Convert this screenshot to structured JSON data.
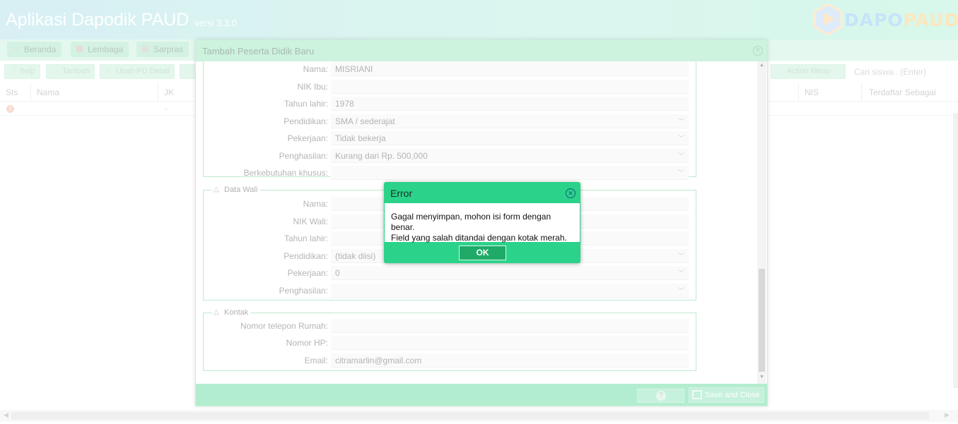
{
  "app": {
    "title": "Aplikasi Dapodik PAUD",
    "version": "versi 3.3.0",
    "logo_a": "DAPO",
    "logo_b": "PAUD"
  },
  "nav": {
    "beranda": "Beranda",
    "lembaga": "Lembaga",
    "sarpras": "Sarpras"
  },
  "toolbar": {
    "help": "help",
    "tambah": "Tambah",
    "ubah": "Ubah PD Detail",
    "action": "Action Menu",
    "search_placeholder": "Cari siswa.. (Enter)"
  },
  "grid": {
    "columns": {
      "sts": "Sts",
      "nama": "Nama",
      "jk": "JK",
      "nis": "NIS",
      "terdaftar": "Terdaftar Sebagai"
    },
    "row": {
      "jk": "-"
    }
  },
  "modal": {
    "title": "Tambah Peserta Didik Baru",
    "ibu": [
      {
        "label": "Nama:",
        "value": "MISRIANI"
      },
      {
        "label": "NIK Ibu:",
        "value": ""
      },
      {
        "label": "Tahun lahir:",
        "value": "1978"
      },
      {
        "label": "Pendidikan:",
        "value": "SMA / sederajat"
      },
      {
        "label": "Pekerjaan:",
        "value": "Tidak bekerja"
      },
      {
        "label": "Penghasilan:",
        "value": "Kurang dari Rp. 500,000"
      },
      {
        "label": "Berkebutuhan khusus:",
        "value": ""
      }
    ],
    "wali_legend": "Data Wali",
    "wali": [
      {
        "label": "Nama:",
        "value": ""
      },
      {
        "label": "NIK Wali:",
        "value": ""
      },
      {
        "label": "Tahun lahir:",
        "value": ""
      },
      {
        "label": "Pendidikan:",
        "value": "(tidak diisi)"
      },
      {
        "label": "Pekerjaan:",
        "value": "0"
      },
      {
        "label": "Penghasilan:",
        "value": ""
      }
    ],
    "kontak_legend": "Kontak",
    "kontak": [
      {
        "label": "Nomor telepon Rumah:",
        "value": ""
      },
      {
        "label": "Nomor HP:",
        "value": ""
      },
      {
        "label": "Email:",
        "value": "citramarlin@gmail.com"
      }
    ],
    "save_label": "Save and Close"
  },
  "error": {
    "title": "Error",
    "line1": "Gagal menyimpan, mohon isi form dengan benar.",
    "line2": "Field yang salah ditandai dengan kotak merah.",
    "ok": "OK"
  },
  "colors": {
    "accent": "#2ad389",
    "header_start": "#b0dfe9",
    "header_end": "#aef0d6"
  }
}
